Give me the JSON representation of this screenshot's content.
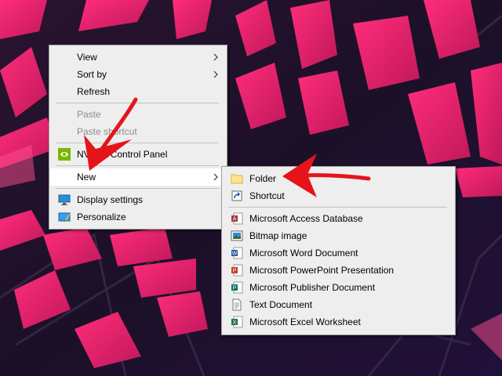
{
  "context_menu": {
    "items": [
      {
        "label": "View"
      },
      {
        "label": "Sort by"
      },
      {
        "label": "Refresh"
      },
      {
        "label": "Paste"
      },
      {
        "label": "Paste shortcut"
      },
      {
        "label": "NVIDIA Control Panel"
      },
      {
        "label": "New"
      },
      {
        "label": "Display settings"
      },
      {
        "label": "Personalize"
      }
    ]
  },
  "new_submenu": {
    "items": [
      {
        "label": "Folder"
      },
      {
        "label": "Shortcut"
      },
      {
        "label": "Microsoft Access Database"
      },
      {
        "label": "Bitmap image"
      },
      {
        "label": "Microsoft Word Document"
      },
      {
        "label": "Microsoft PowerPoint Presentation"
      },
      {
        "label": "Microsoft Publisher Document"
      },
      {
        "label": "Text Document"
      },
      {
        "label": "Microsoft Excel Worksheet"
      }
    ]
  },
  "colors": {
    "wallpaper_base": "#1d0f26",
    "wallpaper_accent": "#e0246a",
    "menu_bg": "#eeeeee",
    "highlight": "#ffffff",
    "annotation_arrow": "#e5141b"
  }
}
